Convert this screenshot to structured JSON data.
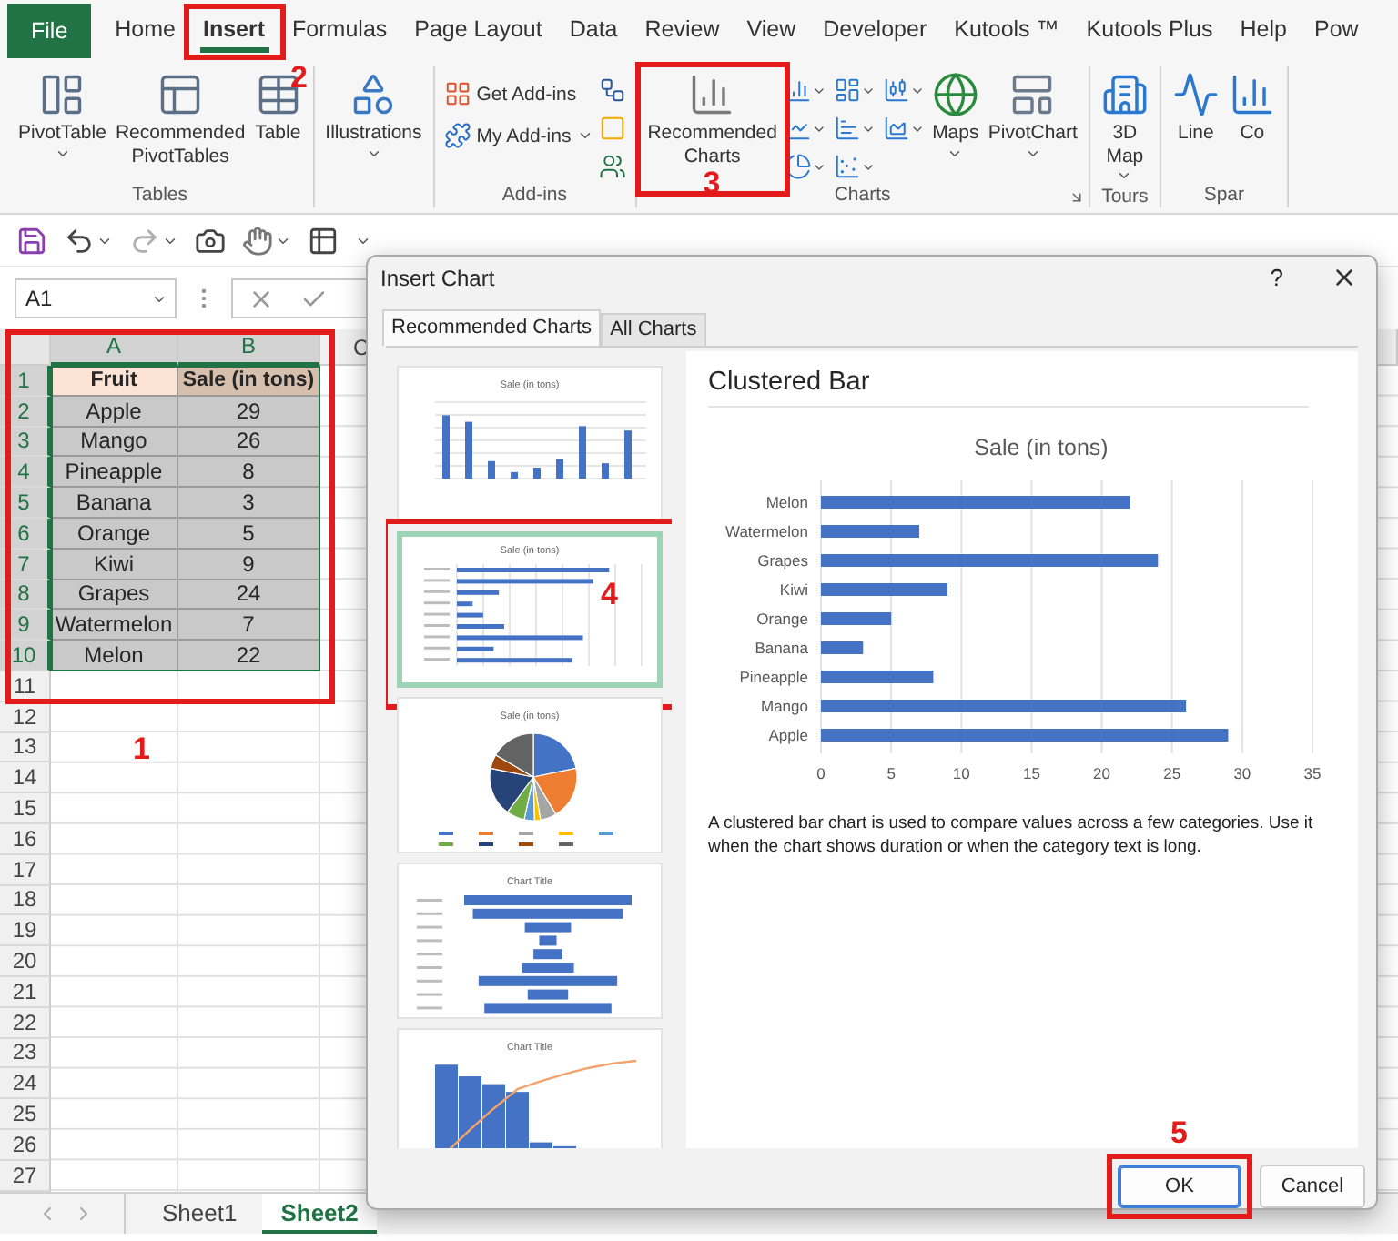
{
  "menu_tabs": [
    {
      "label": "File",
      "kind": "file",
      "selected": false
    },
    {
      "label": "Home",
      "kind": "tab",
      "selected": false
    },
    {
      "label": "Insert",
      "kind": "tab",
      "selected": true,
      "annotation": "2"
    },
    {
      "label": "Formulas",
      "kind": "tab",
      "selected": false
    },
    {
      "label": "Page Layout",
      "kind": "tab",
      "selected": false
    },
    {
      "label": "Data",
      "kind": "tab",
      "selected": false
    },
    {
      "label": "Review",
      "kind": "tab",
      "selected": false
    },
    {
      "label": "View",
      "kind": "tab",
      "selected": false
    },
    {
      "label": "Developer",
      "kind": "tab",
      "selected": false
    },
    {
      "label": "Kutools ™",
      "kind": "tab",
      "selected": false
    },
    {
      "label": "Kutools Plus",
      "kind": "tab",
      "selected": false
    },
    {
      "label": "Help",
      "kind": "tab",
      "selected": false
    },
    {
      "label": "Pow",
      "kind": "tab",
      "selected": false
    }
  ],
  "ribbon": {
    "groups": [
      {
        "label": "Tables",
        "items": [
          {
            "kind": "large",
            "label": "PivotTable",
            "dropdown": true
          },
          {
            "kind": "large",
            "label": "Recommended PivotTables",
            "dropdown": false
          },
          {
            "kind": "large",
            "label": "Table",
            "dropdown": false
          }
        ]
      },
      {
        "items": [
          {
            "kind": "large",
            "label": "Illustrations",
            "dropdown": true
          }
        ]
      },
      {
        "label": "Add-ins",
        "items": [
          {
            "kind": "small",
            "label": "Get Add-ins",
            "dropdown": false
          },
          {
            "kind": "small",
            "label": "My Add-ins",
            "dropdown": true
          },
          {
            "kind": "icons"
          }
        ]
      },
      {
        "label": "Charts",
        "launcher": true,
        "items": [
          {
            "kind": "large",
            "label": "Recommended Charts",
            "dropdown": false,
            "annotation": "3"
          },
          {
            "kind": "icons"
          },
          {
            "kind": "large",
            "label": "Maps",
            "dropdown": true
          },
          {
            "kind": "large",
            "label": "PivotChart",
            "dropdown": true
          }
        ]
      },
      {
        "label": "Tours",
        "items": [
          {
            "kind": "large",
            "label": "3D Map",
            "dropdown": true
          }
        ]
      },
      {
        "label": "Spar",
        "items": [
          {
            "kind": "large",
            "label": "Line",
            "dropdown": false
          },
          {
            "kind": "large",
            "label": "Co",
            "dropdown": false
          }
        ]
      }
    ]
  },
  "formula_bar": {
    "name_box": "A1"
  },
  "sheet": {
    "annotation": "1",
    "columns": [
      {
        "label": "A",
        "selected": true
      },
      {
        "label": "B",
        "selected": true
      },
      {
        "label": "C",
        "selected": false
      }
    ],
    "rows": [
      {
        "number": "1",
        "selected": true,
        "kind": "header",
        "cells": [
          "Fruit",
          "Sale (in tons)"
        ]
      },
      {
        "number": "2",
        "selected": true,
        "kind": "data",
        "cells": [
          "Apple",
          "29"
        ]
      },
      {
        "number": "3",
        "selected": true,
        "kind": "data",
        "cells": [
          "Mango",
          "26"
        ]
      },
      {
        "number": "4",
        "selected": true,
        "kind": "data",
        "cells": [
          "Pineapple",
          "8"
        ]
      },
      {
        "number": "5",
        "selected": true,
        "kind": "data",
        "cells": [
          "Banana",
          "3"
        ]
      },
      {
        "number": "6",
        "selected": true,
        "kind": "data",
        "cells": [
          "Orange",
          "5"
        ]
      },
      {
        "number": "7",
        "selected": true,
        "kind": "data",
        "cells": [
          "Kiwi",
          "9"
        ]
      },
      {
        "number": "8",
        "selected": true,
        "kind": "data",
        "cells": [
          "Grapes",
          "24"
        ]
      },
      {
        "number": "9",
        "selected": true,
        "kind": "data",
        "cells": [
          "Watermelon",
          "7"
        ]
      },
      {
        "number": "10",
        "selected": true,
        "kind": "data",
        "cells": [
          "Melon",
          "22"
        ]
      },
      {
        "number": "11",
        "selected": false
      },
      {
        "number": "12",
        "selected": false
      },
      {
        "number": "13",
        "selected": false
      },
      {
        "number": "14",
        "selected": false
      },
      {
        "number": "15",
        "selected": false
      },
      {
        "number": "16",
        "selected": false
      },
      {
        "number": "17",
        "selected": false
      },
      {
        "number": "18",
        "selected": false
      },
      {
        "number": "19",
        "selected": false
      },
      {
        "number": "20",
        "selected": false
      },
      {
        "number": "21",
        "selected": false
      },
      {
        "number": "22",
        "selected": false
      },
      {
        "number": "23",
        "selected": false
      },
      {
        "number": "24",
        "selected": false
      },
      {
        "number": "25",
        "selected": false
      },
      {
        "number": "26",
        "selected": false
      },
      {
        "number": "27",
        "selected": false
      }
    ],
    "sheet_tabs": [
      {
        "label": "Sheet1",
        "selected": false
      },
      {
        "label": "Sheet2",
        "selected": true
      }
    ]
  },
  "dialog": {
    "title": "Insert Chart",
    "help": "?",
    "tabs": [
      {
        "label": "Recommended Charts",
        "selected": true
      },
      {
        "label": "All Charts",
        "selected": false
      }
    ],
    "thumbnails": [
      {
        "kind": "column",
        "title": "Sale (in tons)",
        "selected": false
      },
      {
        "kind": "bar",
        "title": "Sale (in tons)",
        "selected": true,
        "annotation": "4"
      },
      {
        "kind": "pie",
        "title": "Sale (in tons)",
        "selected": false
      },
      {
        "kind": "funnel",
        "title": "Chart Title",
        "selected": false
      },
      {
        "kind": "pareto",
        "title": "Chart Title",
        "selected": false
      }
    ],
    "preview": {
      "heading": "Clustered Bar",
      "chart_data": {
        "type": "bar",
        "orientation": "horizontal",
        "title": "Sale (in tons)",
        "categories": [
          "Melon",
          "Watermelon",
          "Grapes",
          "Kiwi",
          "Orange",
          "Banana",
          "Pineapple",
          "Mango",
          "Apple"
        ],
        "series": [
          {
            "color": "#4472c4",
            "values": [
              22,
              7,
              24,
              9,
              5,
              3,
              8,
              26,
              29
            ]
          }
        ],
        "xlim": [
          0,
          35
        ],
        "xticks": [
          0,
          5,
          10,
          15,
          20,
          25,
          30,
          35
        ],
        "grid": true
      },
      "description": "A clustered bar chart is used to compare values across a few categories. Use it when the chart shows duration or when the category text is long."
    },
    "buttons": [
      {
        "label": "OK",
        "kind": "primary",
        "annotation": "5"
      },
      {
        "label": "Cancel",
        "kind": "secondary"
      }
    ]
  }
}
